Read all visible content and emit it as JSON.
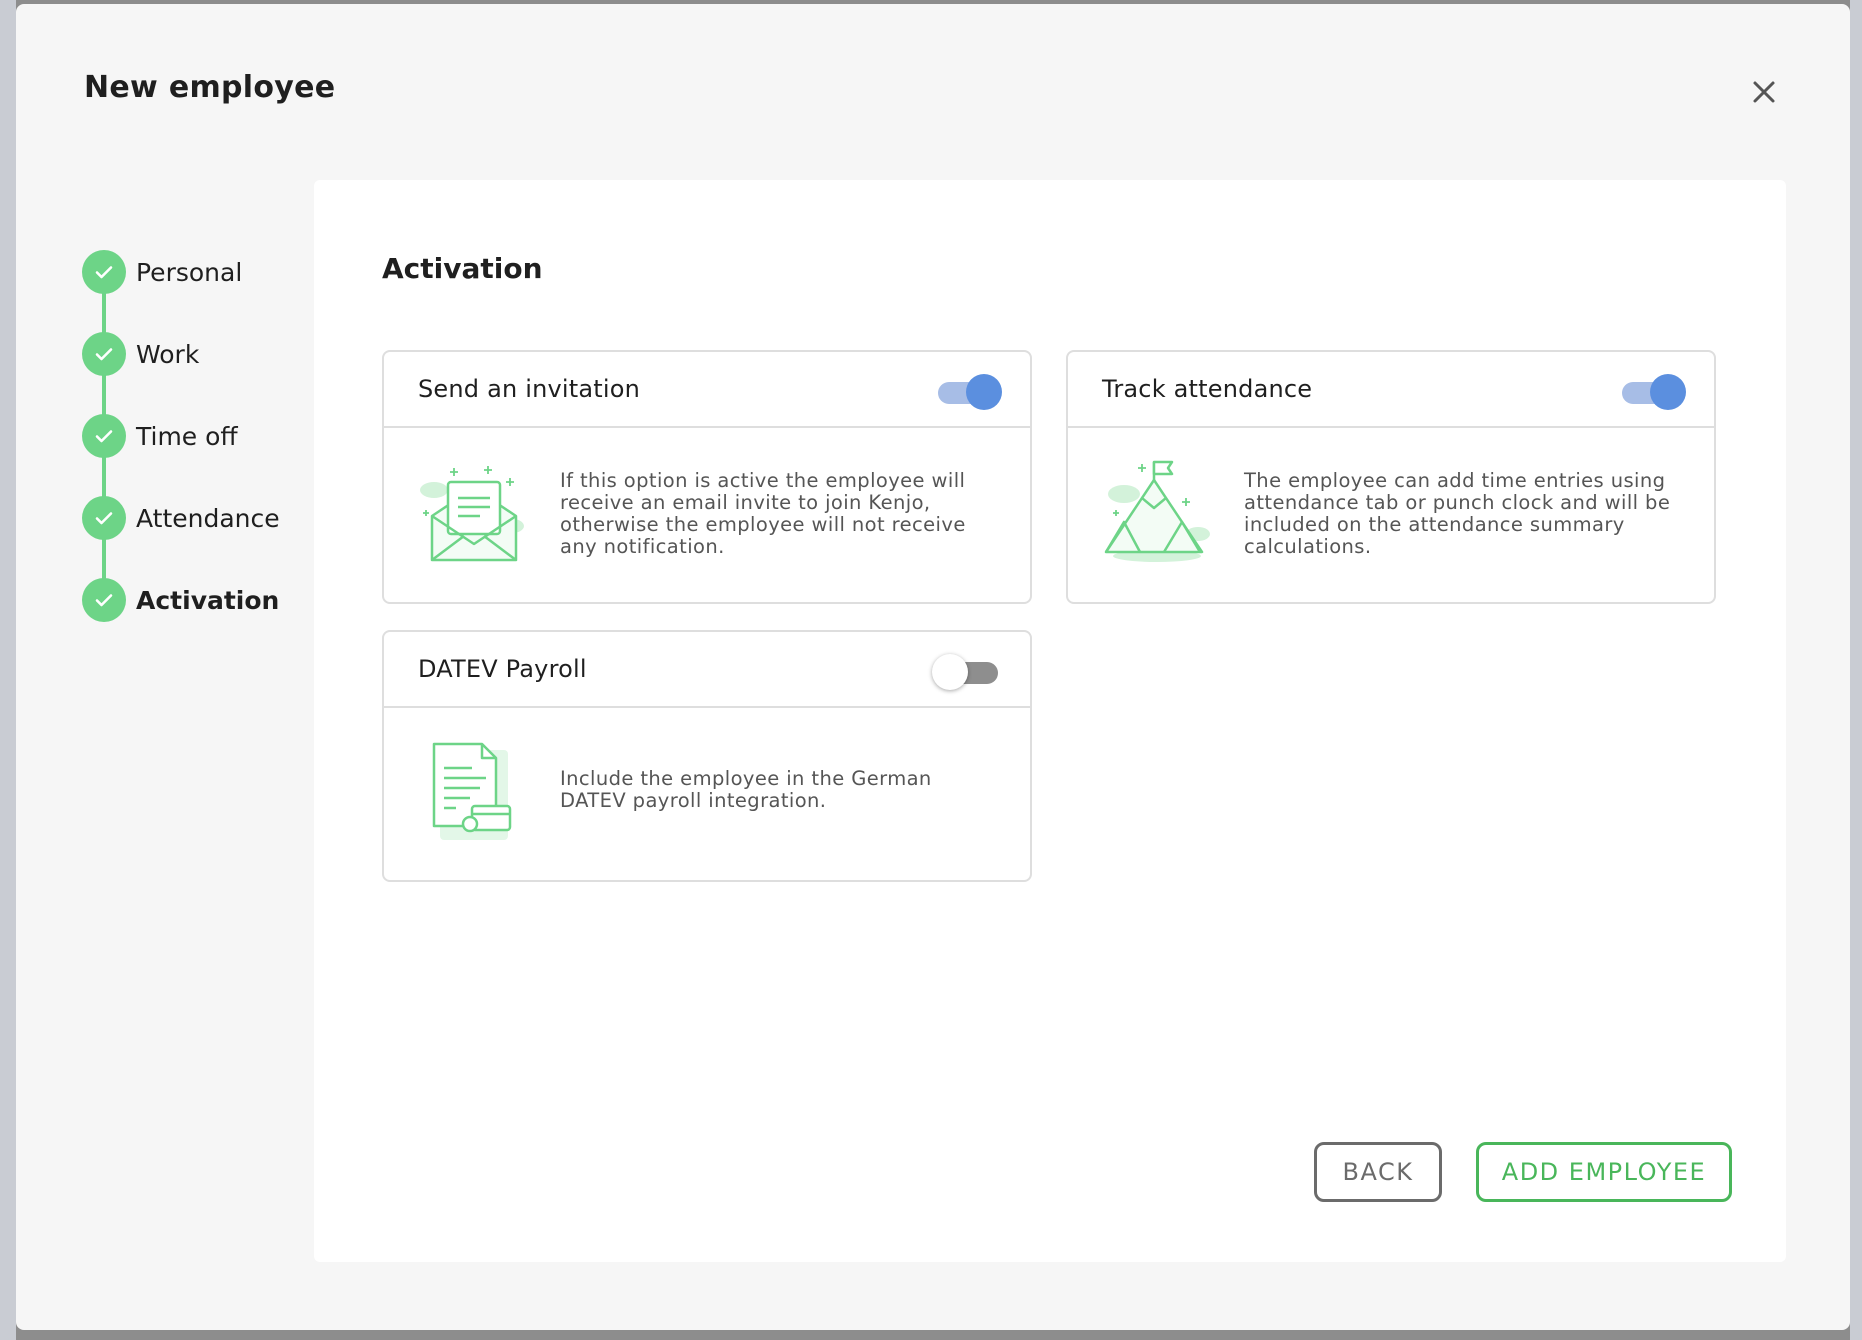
{
  "dialog": {
    "title": "New employee",
    "close_icon": "close-icon"
  },
  "stepper": {
    "steps": [
      {
        "label": "Personal",
        "status": "completed"
      },
      {
        "label": "Work",
        "status": "completed"
      },
      {
        "label": "Time off",
        "status": "completed"
      },
      {
        "label": "Attendance",
        "status": "completed"
      },
      {
        "label": "Activation",
        "status": "active"
      }
    ]
  },
  "section": {
    "title": "Activation"
  },
  "cards": [
    {
      "title": "Send an invitation",
      "enabled": true,
      "icon": "envelope-icon",
      "description": "If this option is active the employee will receive an email invite to join Kenjo, otherwise the employee will not receive any notification."
    },
    {
      "title": "Track attendance",
      "enabled": true,
      "icon": "mountain-flag-icon",
      "description": "The employee can add time entries using attendance tab or punch clock and will be included on the attendance summary calculations."
    },
    {
      "title": "DATEV Payroll",
      "enabled": false,
      "icon": "payroll-document-icon",
      "description": "Include the employee in the German DATEV payroll integration."
    }
  ],
  "actions": {
    "back_label": "BACK",
    "add_label": "ADD EMPLOYEE"
  },
  "colors": {
    "success": "#6dd487",
    "toggle_on": "#5b8fdf",
    "primary_green": "#49b65a"
  }
}
